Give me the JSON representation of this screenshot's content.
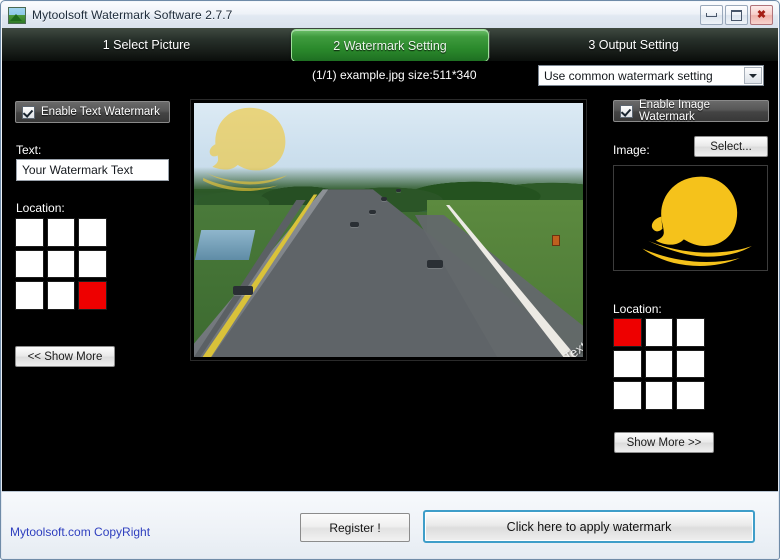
{
  "window": {
    "title": "Mytoolsoft Watermark Software 2.7.7",
    "app_icon": "landscape-icon",
    "minimize_label": "–",
    "maximize_label": "□",
    "close_label": "✕"
  },
  "tabs": [
    {
      "label": "1 Select Picture",
      "active": false
    },
    {
      "label": "2 Watermark Setting",
      "active": true
    },
    {
      "label": "3 Output Setting",
      "active": false
    }
  ],
  "infobar": {
    "file_info": "(1/1) example.jpg size:511*340",
    "preset_value": "Use common watermark setting",
    "preset_icon": "chevron-down-icon"
  },
  "text_panel": {
    "enable_label": "Enable Text Watermark",
    "text_label": "Text:",
    "text_value": "Your Watermark Text",
    "location_label": "Location:",
    "location_selected_index": 8,
    "show_more_label": "<< Show More"
  },
  "image_panel": {
    "enable_label": "Enable Image Watermark",
    "image_label": "Image:",
    "select_label": "Select...",
    "location_label": "Location:",
    "location_selected_index": 0,
    "show_more_label": "Show More >>"
  },
  "preview": {
    "watermark_text": "Your Watermark Text",
    "logo_name": "yellow-face-silhouette"
  },
  "footer": {
    "copyright": "Mytoolsoft.com CopyRight",
    "register_label": "Register !",
    "apply_label": "Click here to apply watermark"
  },
  "colors": {
    "accent_green": "#2b8a2c",
    "selected_cell": "#ee0000",
    "logo_yellow": "#f5c21b",
    "apply_border": "#3f9ec9",
    "copyright_link": "#2f3fbf"
  }
}
